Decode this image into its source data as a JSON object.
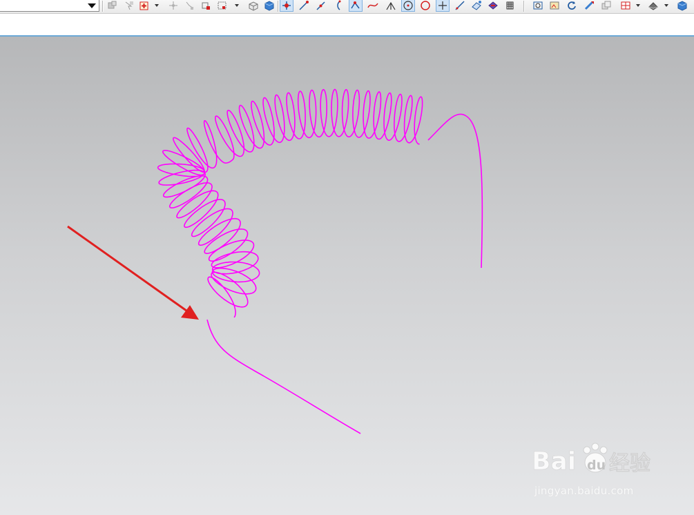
{
  "toolbar": {
    "selection_filter_value": "",
    "icons": [
      "filter-icon",
      "pick-icon",
      "snap-point-icon",
      "point-icon",
      "move-icon",
      "select-box-icon",
      "box-render-icon",
      "cube-icon",
      "snap-all-icon",
      "line-end-icon",
      "line-mid-icon",
      "curve-icon",
      "control-point-icon",
      "spline-icon",
      "intersect-icon",
      "center-icon",
      "quadrant-icon",
      "point-on-curve-icon",
      "line-tangent-icon",
      "face-icon",
      "edit-icon",
      "grid-icon",
      "fit-view-icon",
      "image-icon",
      "rotate-icon",
      "pan-icon",
      "render-icon",
      "layout-icon",
      "shade-icon",
      "view-cube-icon"
    ],
    "colors": {
      "accent": "#3a7fd0",
      "snap_red": "#d42020",
      "active_bg": "#cfe3f7"
    }
  },
  "viewport": {
    "curve_color": "#ff00ff",
    "arrow_color": "#e02020",
    "background_top": "#b6b7b9",
    "background_bottom": "#e6e7e9"
  },
  "watermark": {
    "brand_latin_1": "Bai",
    "brand_latin_2": "du",
    "brand_cjk": "经验",
    "url": "jingyan.baidu.com"
  }
}
